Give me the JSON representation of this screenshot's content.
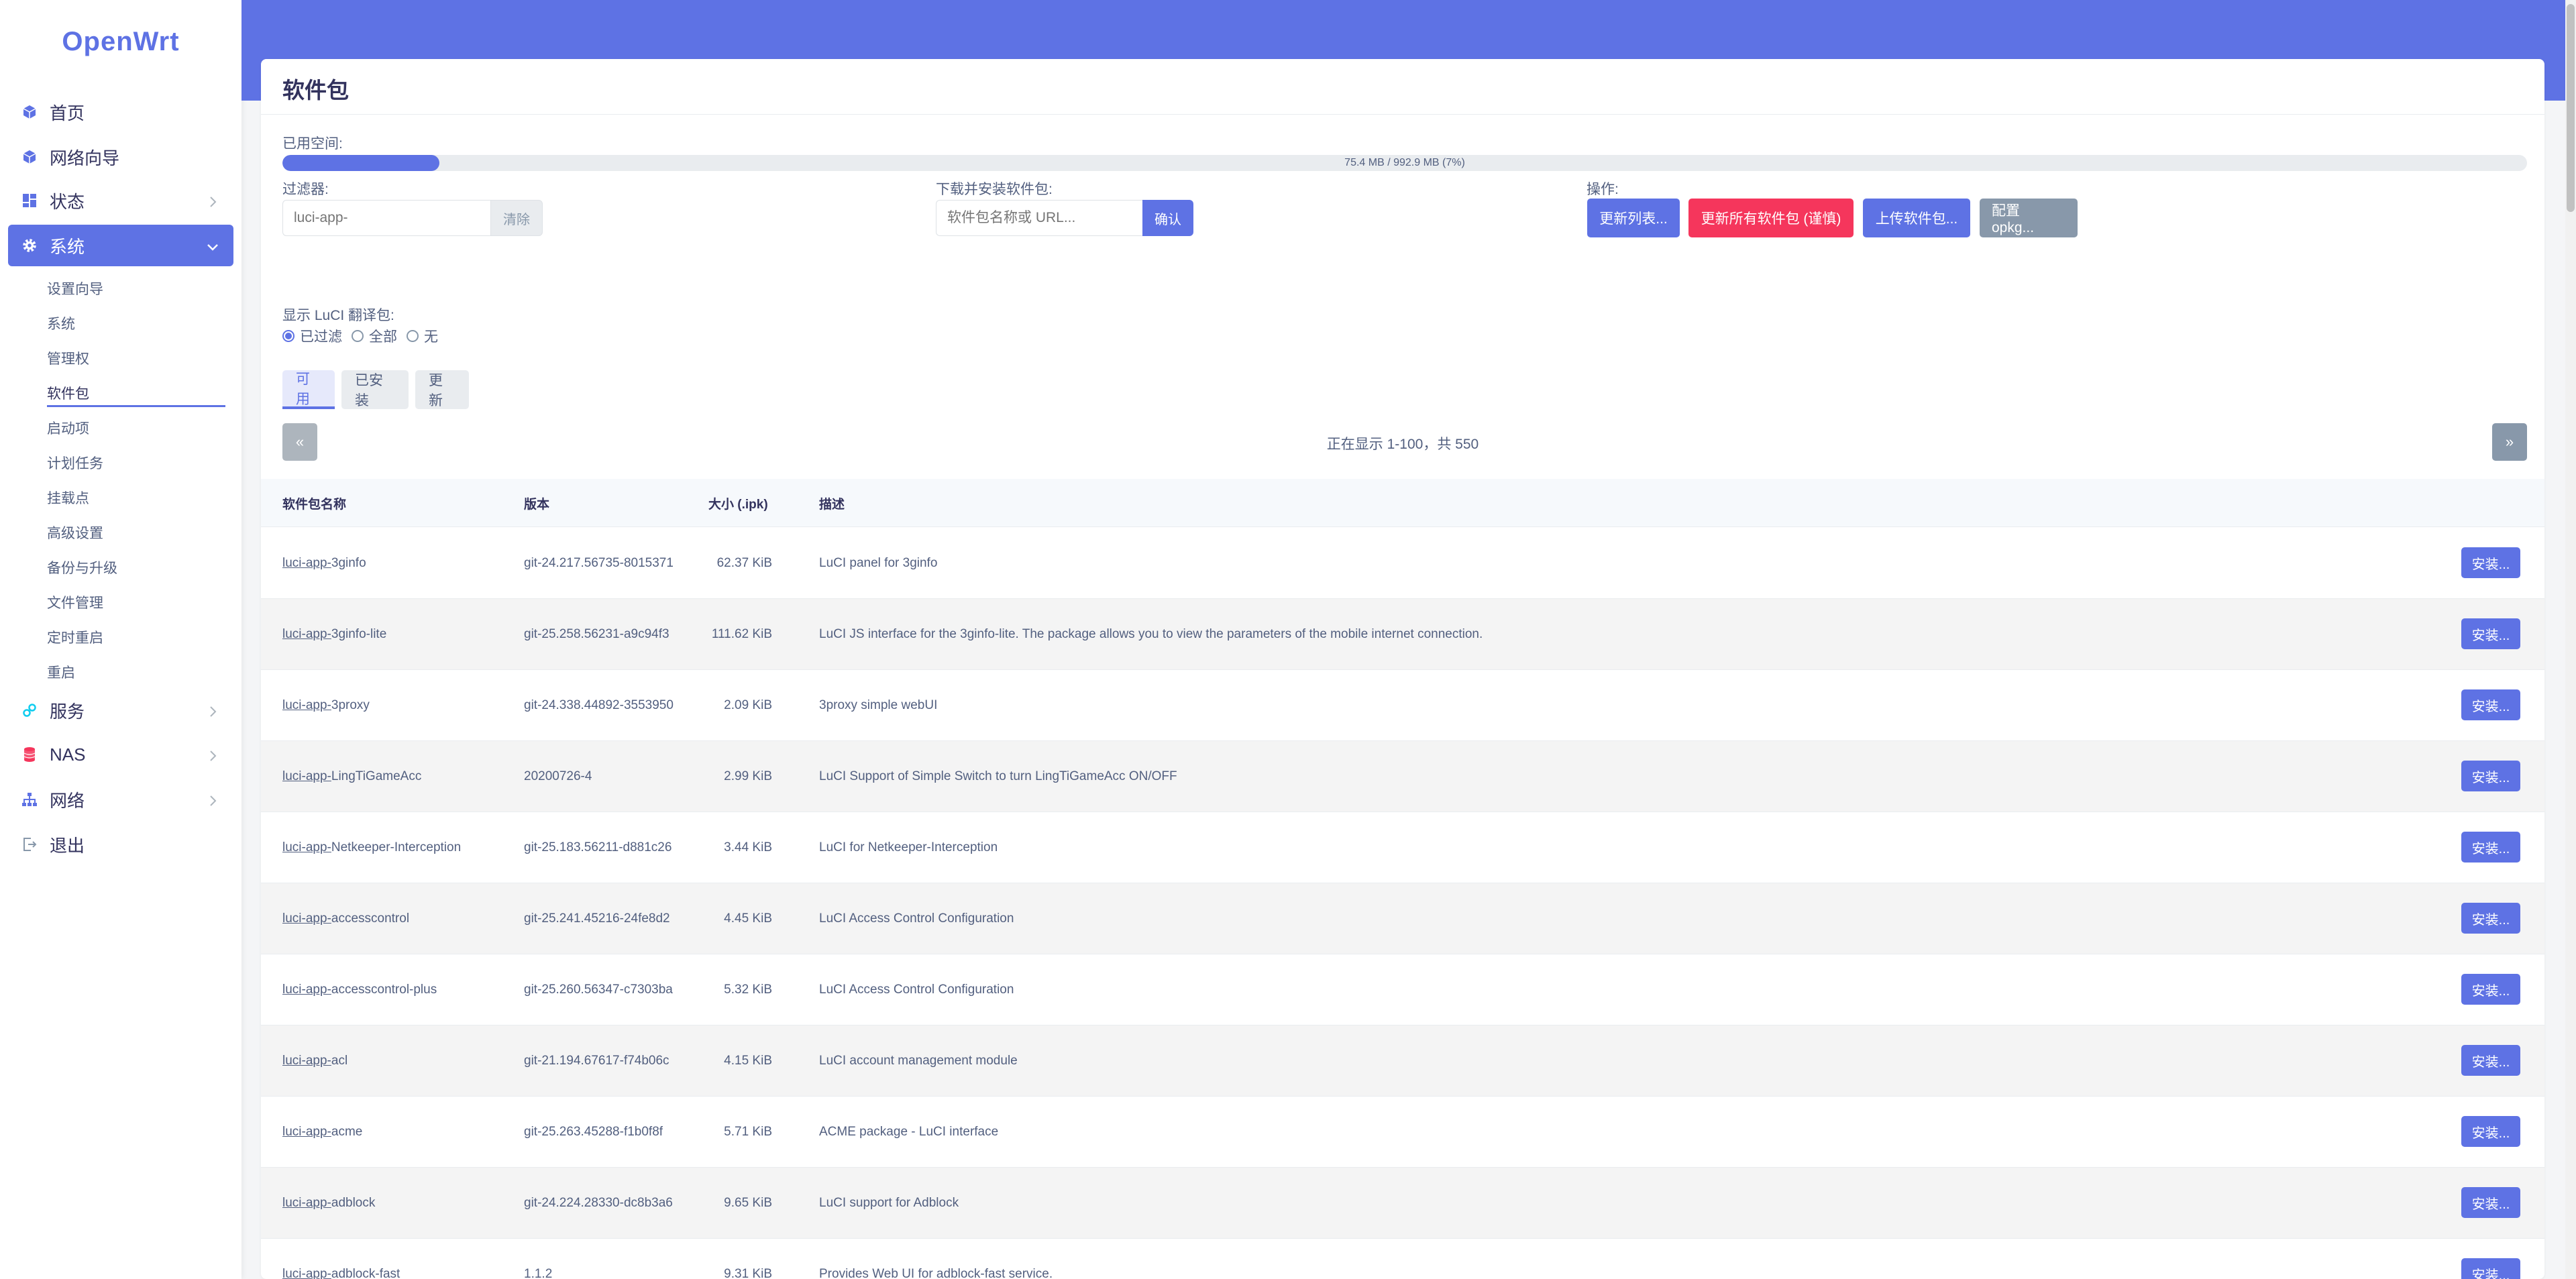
{
  "brand": "OpenWrt",
  "sidebar": {
    "items": [
      {
        "label": "首页",
        "icon": "cube-icon"
      },
      {
        "label": "网络向导",
        "icon": "cube-icon"
      },
      {
        "label": "状态",
        "icon": "dashboard-icon"
      },
      {
        "label": "系统",
        "icon": "gear-icon"
      },
      {
        "label": "服务",
        "icon": "link-icon"
      },
      {
        "label": "NAS",
        "icon": "database-icon"
      },
      {
        "label": "网络",
        "icon": "sitemap-icon"
      },
      {
        "label": "退出",
        "icon": "logout-icon"
      }
    ],
    "sub_items": [
      "设置向导",
      "系统",
      "管理权",
      "软件包",
      "启动项",
      "计划任务",
      "挂载点",
      "高级设置",
      "备份与升级",
      "文件管理",
      "定时重启",
      "重启"
    ]
  },
  "page": {
    "title": "软件包",
    "used_space_label": "已用空间:",
    "used_space_text": "75.4 MB / 992.9 MB (7%)",
    "used_fraction": 0.07,
    "filter_label": "过滤器:",
    "filter_placeholder": "luci-app-",
    "clear_label": "清除",
    "download_label": "下载并安装软件包:",
    "download_placeholder": "软件包名称或 URL...",
    "confirm_label": "确认",
    "actions_label": "操作:",
    "btn_update_lists": "更新列表...",
    "btn_upgrade_all": "更新所有软件包 (谨慎)",
    "btn_upload": "上传软件包...",
    "btn_configure": "配置 opkg...",
    "luci_label": "显示 LuCI 翻译包:",
    "radio_filtered": "已过滤",
    "radio_all": "全部",
    "radio_none": "无",
    "tabs": [
      "可用",
      "已安装",
      "更新"
    ],
    "prev": "«",
    "next": "»",
    "showing": "正在显示 1-100，共 550",
    "colors": {
      "accent": "#5e72e4",
      "danger": "#f5365c",
      "neutral": "#8898aa"
    }
  },
  "table": {
    "headers": {
      "name": "软件包名称",
      "version": "版本",
      "size": "大小 (.ipk)",
      "desc": "描述"
    },
    "install_label": "安装...",
    "rows": [
      {
        "pre": "luci-app-",
        "name": "3ginfo",
        "version": "git-24.217.56735-8015371",
        "size": "62.37 KiB",
        "desc": "LuCI panel for 3ginfo"
      },
      {
        "pre": "luci-app-",
        "name": "3ginfo-lite",
        "version": "git-25.258.56231-a9c94f3",
        "size": "111.62 KiB",
        "desc": "LuCI JS interface for the 3ginfo-lite. The package allows you to view the parameters of the mobile internet connection."
      },
      {
        "pre": "luci-app-",
        "name": "3proxy",
        "version": "git-24.338.44892-3553950",
        "size": "2.09 KiB",
        "desc": "3proxy simple webUI"
      },
      {
        "pre": "luci-app-",
        "name": "LingTiGameAcc",
        "version": "20200726-4",
        "size": "2.99 KiB",
        "desc": "LuCI Support of Simple Switch to turn LingTiGameAcc ON/OFF"
      },
      {
        "pre": "luci-app-",
        "name": "Netkeeper-Interception",
        "version": "git-25.183.56211-d881c26",
        "size": "3.44 KiB",
        "desc": "LuCI for Netkeeper-Interception"
      },
      {
        "pre": "luci-app-",
        "name": "accesscontrol",
        "version": "git-25.241.45216-24fe8d2",
        "size": "4.45 KiB",
        "desc": "LuCI Access Control Configuration"
      },
      {
        "pre": "luci-app-",
        "name": "accesscontrol-plus",
        "version": "git-25.260.56347-c7303ba",
        "size": "5.32 KiB",
        "desc": "LuCI Access Control Configuration"
      },
      {
        "pre": "luci-app-",
        "name": "acl",
        "version": "git-21.194.67617-f74b06c",
        "size": "4.15 KiB",
        "desc": "LuCI account management module"
      },
      {
        "pre": "luci-app-",
        "name": "acme",
        "version": "git-25.263.45288-f1b0f8f",
        "size": "5.71 KiB",
        "desc": "ACME package - LuCI interface"
      },
      {
        "pre": "luci-app-",
        "name": "adblock",
        "version": "git-24.224.28330-dc8b3a6",
        "size": "9.65 KiB",
        "desc": "LuCI support for Adblock"
      },
      {
        "pre": "luci-app-",
        "name": "adblock-fast",
        "version": "1.1.2",
        "size": "9.31 KiB",
        "desc": "Provides Web UI for adblock-fast service."
      }
    ]
  }
}
